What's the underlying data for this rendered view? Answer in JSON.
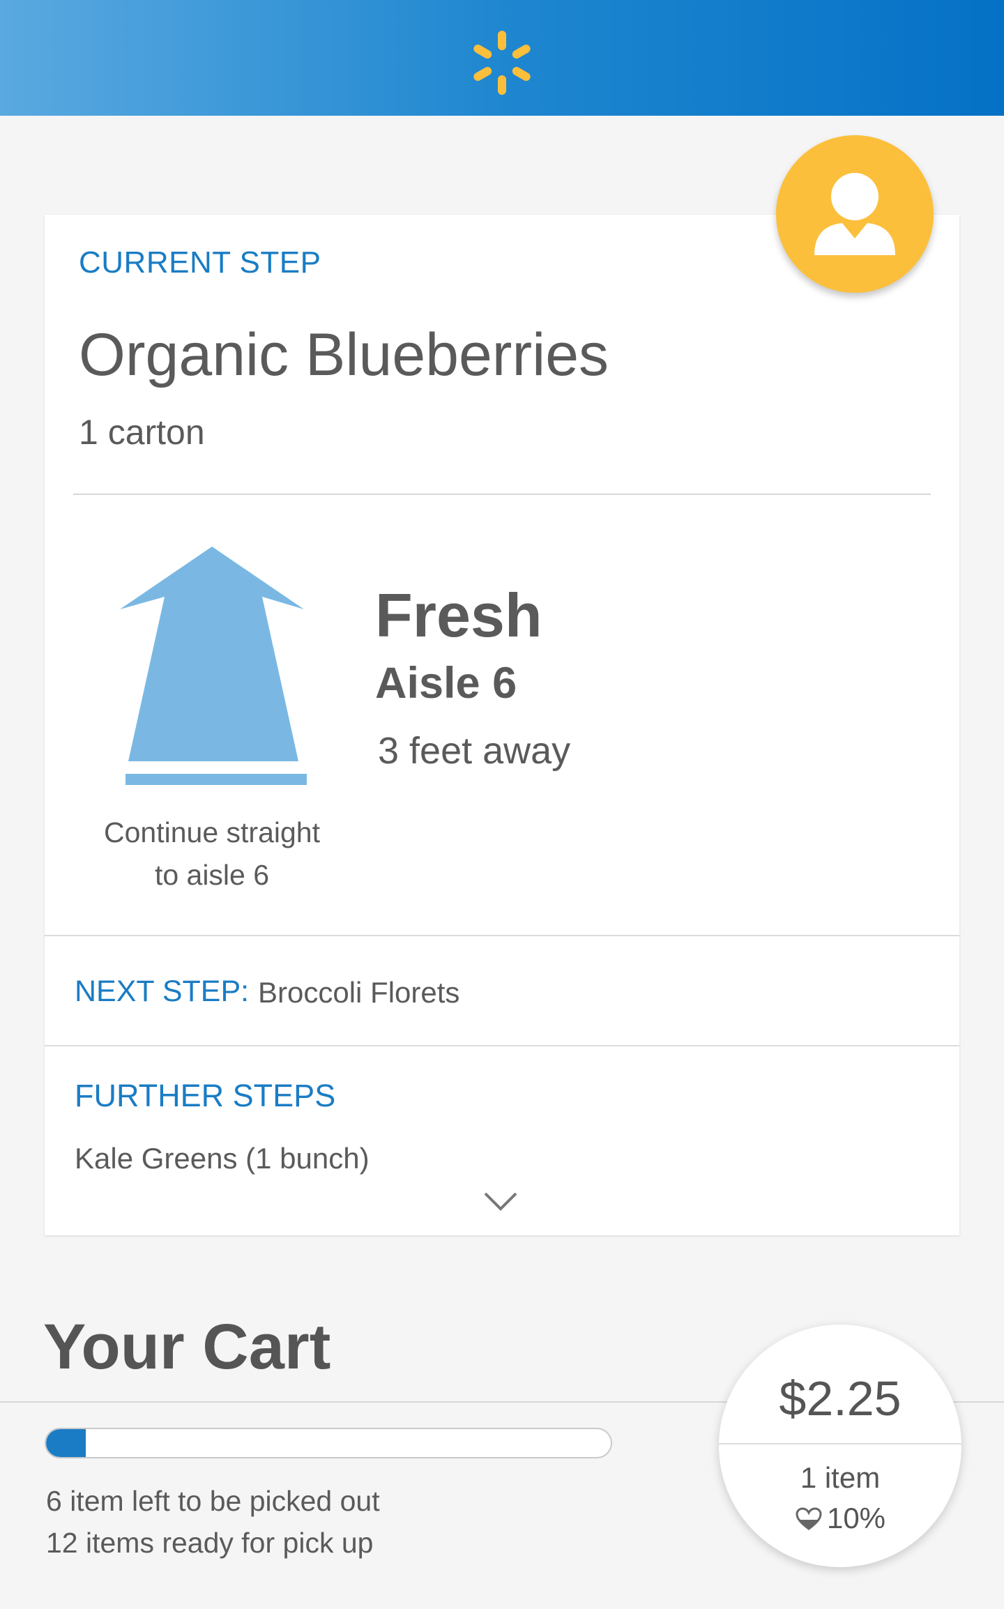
{
  "header": {
    "logo_icon": "walmart-spark-icon",
    "brand_color": "#0571c6",
    "spark_color": "#fcbf3b"
  },
  "profile": {
    "icon": "user-icon",
    "color": "#fcbf3b"
  },
  "current_step": {
    "label": "CURRENT STEP",
    "item_name": "Organic Blueberries",
    "quantity": "1 carton",
    "direction_icon": "straight-arrow-icon",
    "instruction_line1": "Continue straight",
    "instruction_line2": "to aisle 6",
    "department": "Fresh",
    "aisle": "Aisle 6",
    "distance": "3 feet away"
  },
  "next_step": {
    "label": "NEXT STEP:",
    "item": "Broccoli Florets"
  },
  "further_steps": {
    "label": "FURTHER STEPS",
    "items": [
      "Kale Greens (1 bunch)"
    ],
    "expand_icon": "chevron-down-icon"
  },
  "cart": {
    "title": "Your Cart",
    "progress_fraction": 0.07,
    "status_left": "6 item left to be picked out",
    "status_ready": "12 items ready for pick up",
    "total": "$2.25",
    "item_count": "1 item",
    "health_icon": "heart-icon",
    "health_percent": "10%",
    "accent_color": "#1a7cc4"
  }
}
